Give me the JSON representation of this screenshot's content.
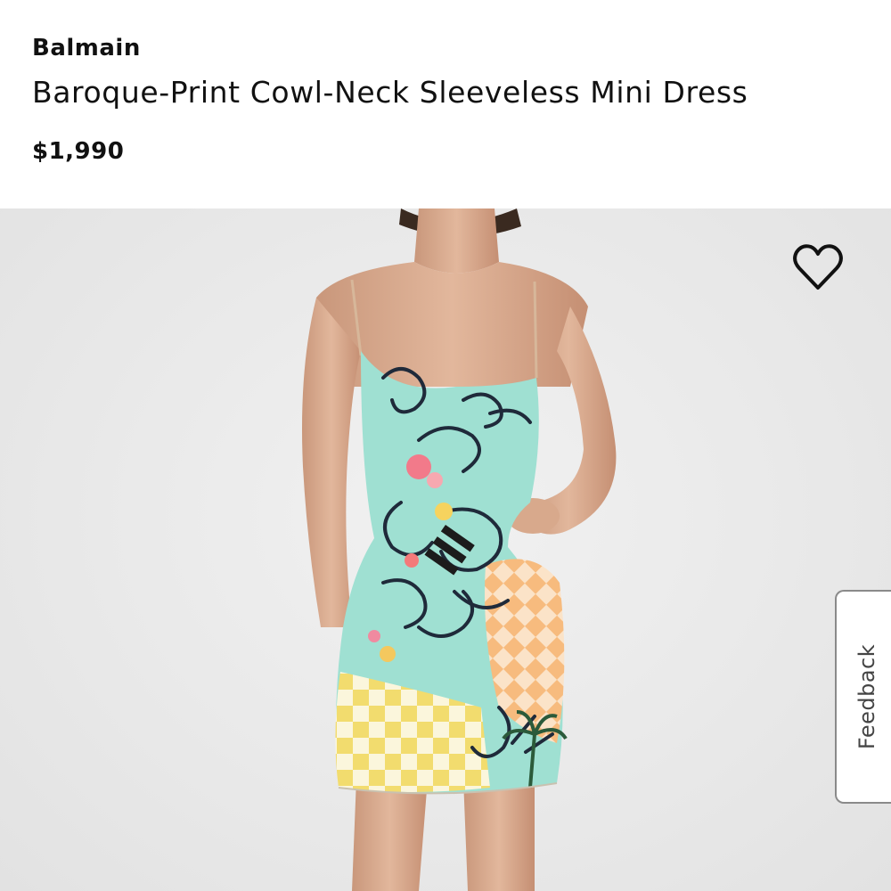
{
  "product": {
    "brand": "Balmain",
    "name": "Baroque-Print Cowl-Neck Sleeveless Mini Dress",
    "price": "$1,990"
  },
  "wishlist": {
    "icon": "heart-outline-icon"
  },
  "feedback": {
    "label": "Feedback"
  },
  "colors": {
    "text": "#111111",
    "image_background": "#e9e9e9",
    "feedback_border": "#8a8a8a"
  }
}
